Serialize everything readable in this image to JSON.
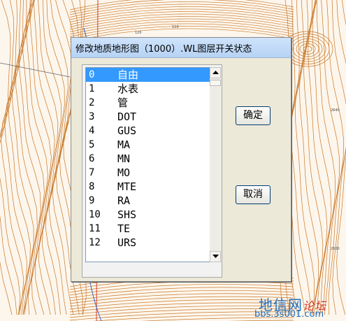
{
  "dialog": {
    "title": "修改地质地形图（1000）.WL图层开关状态",
    "ok_label": "确定",
    "cancel_label": "取消",
    "layers": [
      {
        "index": "0",
        "name": "自由"
      },
      {
        "index": "1",
        "name": "水表"
      },
      {
        "index": "2",
        "name": "管"
      },
      {
        "index": "3",
        "name": "DOT"
      },
      {
        "index": "4",
        "name": "GUS"
      },
      {
        "index": "5",
        "name": "MA"
      },
      {
        "index": "6",
        "name": "MN"
      },
      {
        "index": "7",
        "name": "MO"
      },
      {
        "index": "8",
        "name": "MTE"
      },
      {
        "index": "9",
        "name": "RA"
      },
      {
        "index": "10",
        "name": "SHS"
      },
      {
        "index": "11",
        "name": "TE"
      },
      {
        "index": "12",
        "name": "URS"
      }
    ],
    "selected_index": 0
  },
  "map": {
    "labels": {
      "grid_a": "2640",
      "grid_b": "2600",
      "contour_a": "120",
      "contour_b": "110"
    }
  },
  "watermark": {
    "line1": "地信网",
    "line1_accent": "论坛",
    "line2": "bbs.3s001.com"
  },
  "colors": {
    "contour": "#c8782a",
    "selection": "#3399ff",
    "title_bar": "#c1d9f7"
  }
}
